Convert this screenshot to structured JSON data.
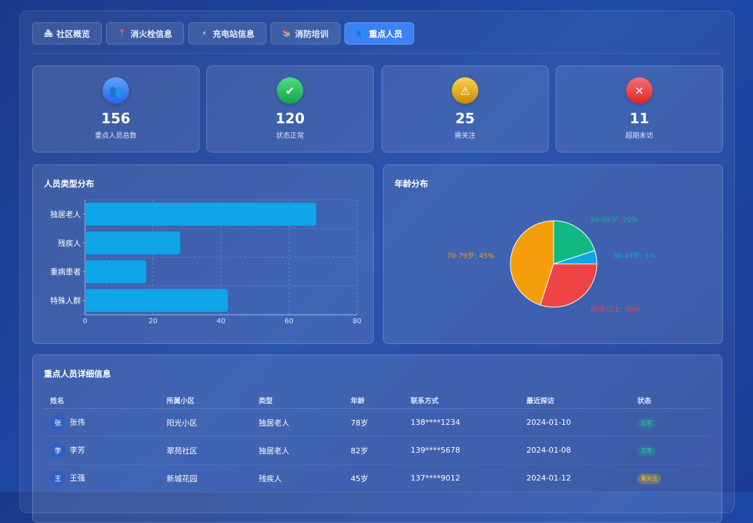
{
  "tabs": [
    {
      "label": "社区概览",
      "icon": "🏘",
      "active": false
    },
    {
      "label": "消火栓信息",
      "icon": "📍",
      "active": false
    },
    {
      "label": "充电站信息",
      "icon": "⚡",
      "active": false
    },
    {
      "label": "消防培训",
      "icon": "📚",
      "active": false
    },
    {
      "label": "重点人员",
      "icon": "👥",
      "active": true
    }
  ],
  "stats": [
    {
      "value": "156",
      "label": "重点人员总数",
      "icon": "👥",
      "color": "#3b82f6"
    },
    {
      "value": "120",
      "label": "状态正常",
      "icon": "✔",
      "color": "#22c55e"
    },
    {
      "value": "25",
      "label": "需关注",
      "icon": "⚠",
      "color": "#eab308"
    },
    {
      "value": "11",
      "label": "超期未访",
      "icon": "✕",
      "color": "#ef4444"
    }
  ],
  "type_panel": {
    "title": "人员类型分布"
  },
  "age_panel": {
    "title": "年龄分布"
  },
  "chart_data": [
    {
      "type": "bar",
      "orientation": "horizontal",
      "categories": [
        "独居老人",
        "残疾人",
        "重病患者",
        "特殊人群"
      ],
      "values": [
        68,
        28,
        18,
        42
      ],
      "xlim": [
        0,
        80
      ],
      "xticks": [
        0,
        20,
        40,
        60,
        80
      ],
      "color": "#0ea5e9",
      "grid": true
    },
    {
      "type": "pie",
      "labels": [
        "50-69岁",
        "30-49岁",
        "80岁以上",
        "70-79岁"
      ],
      "values": [
        20,
        5,
        30,
        45
      ],
      "display_labels": [
        "50-69岁: 20%",
        "30-49岁: 5%",
        "80岁以上: 30%",
        "70-79岁: 45%"
      ],
      "colors": [
        "#10b981",
        "#0ea5e9",
        "#ef4444",
        "#f59e0b"
      ]
    }
  ],
  "table": {
    "title": "重点人员详细信息",
    "headers": [
      "姓名",
      "所属小区",
      "类型",
      "年龄",
      "联系方式",
      "最近探访",
      "状态"
    ],
    "rows": [
      {
        "avatar": "张",
        "name": "张伟",
        "community": "阳光小区",
        "type": "独居老人",
        "age": "78岁",
        "phone": "138****1234",
        "visit": "2024-01-10",
        "status": "正常",
        "status_kind": "ok"
      },
      {
        "avatar": "李",
        "name": "李芳",
        "community": "翠苑社区",
        "type": "独居老人",
        "age": "82岁",
        "phone": "139****5678",
        "visit": "2024-01-08",
        "status": "正常",
        "status_kind": "ok"
      },
      {
        "avatar": "王",
        "name": "王强",
        "community": "新城花园",
        "type": "残疾人",
        "age": "45岁",
        "phone": "137****9012",
        "visit": "2024-01-12",
        "status": "需关注",
        "status_kind": "warn"
      }
    ]
  }
}
